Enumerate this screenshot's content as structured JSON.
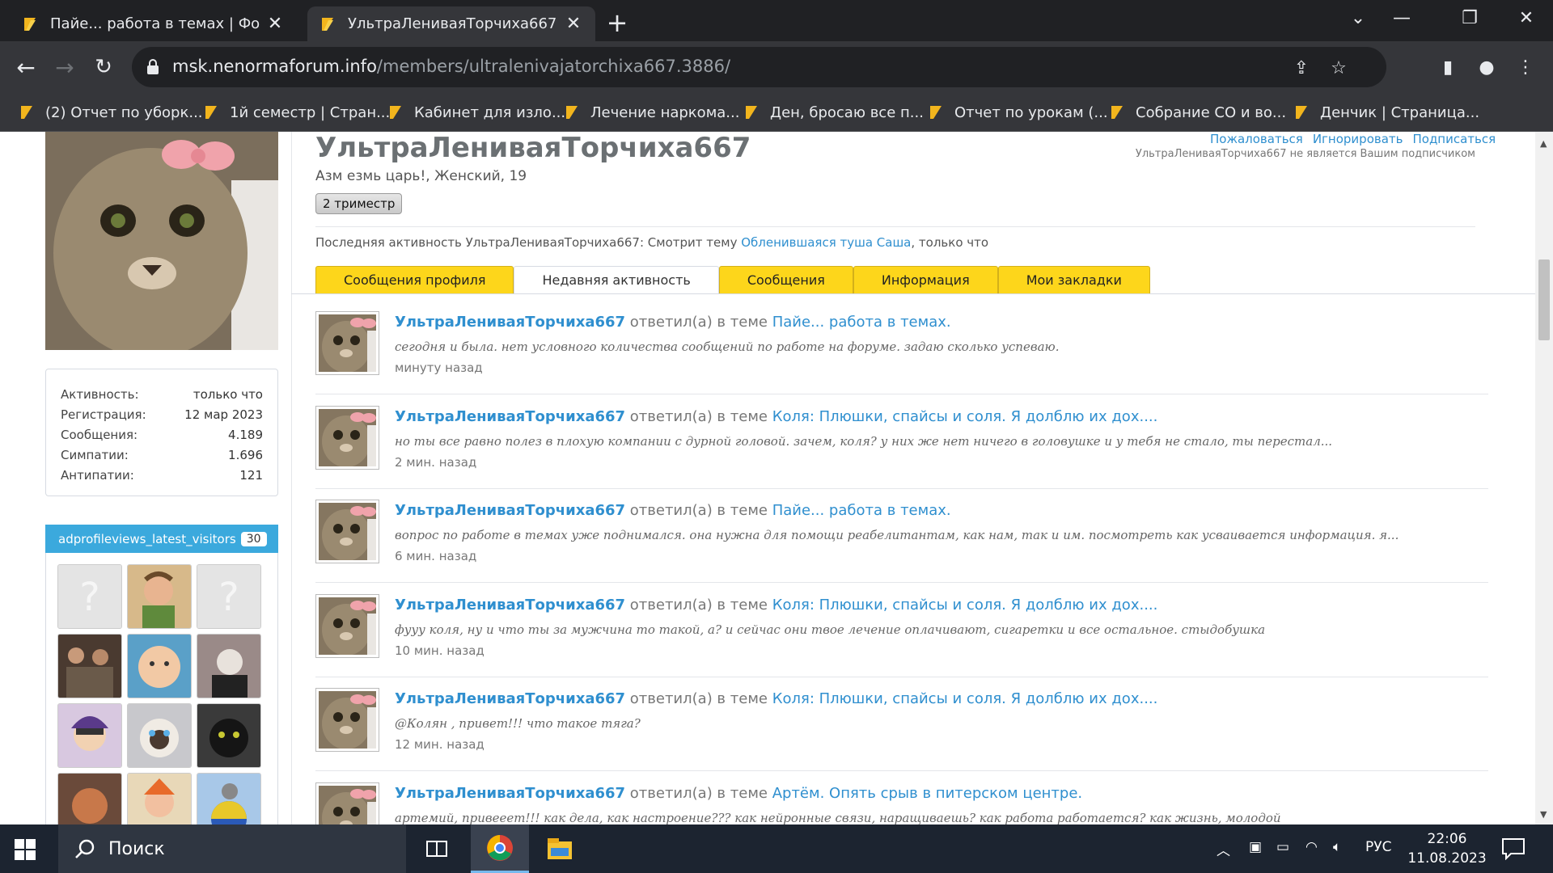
{
  "browser": {
    "tabs": [
      {
        "title": "Пайе... работа в темах | Форум р",
        "active": false
      },
      {
        "title": "УльтраЛениваяТорчиха667 | Фо",
        "active": true
      }
    ],
    "url_host": "msk.nenormaforum.info",
    "url_path": "/members/ultralenivajatorchixa667.3886/",
    "bookmarks": [
      "(2) Отчет по уборк...",
      "1й семестр | Стран...",
      "Кабинет для изло...",
      "Лечение наркома...",
      "Ден, бросаю все п...",
      "Отчет по урокам (...",
      "Собрание СО и во...",
      "Денчик | Страница..."
    ]
  },
  "profile": {
    "name": "УльтраЛениваяТорчиха667",
    "subtitle": "Азм езмь царь!, Женский, 19",
    "badge": "2 триместр",
    "actions": {
      "report": "Пожаловаться",
      "ignore": "Игнорировать",
      "follow": "Подписаться"
    },
    "follow_status": "УльтраЛениваяТорчиха667 не является Вашим подписчиком",
    "last_activity_prefix": "Последняя активность УльтраЛениваяТорчиха667: Смотрит тему",
    "last_activity_thread": "Обленившаяся туша Саша",
    "last_activity_suffix": ", только что"
  },
  "stats": [
    {
      "label": "Активность:",
      "value": "только что"
    },
    {
      "label": "Регистрация:",
      "value": "12 мар 2023"
    },
    {
      "label": "Сообщения:",
      "value": "4.189"
    },
    {
      "label": "Симпатии:",
      "value": "1.696"
    },
    {
      "label": "Антипатии:",
      "value": "121"
    }
  ],
  "visitors": {
    "title": "adprofileviews_latest_visitors",
    "count": "30"
  },
  "tabs": [
    {
      "label": "Сообщения профиля",
      "active": false
    },
    {
      "label": "Недавняя активность",
      "active": true
    },
    {
      "label": "Сообщения",
      "active": false
    },
    {
      "label": "Информация",
      "active": false
    },
    {
      "label": "Мои закладки",
      "active": false
    }
  ],
  "activity": [
    {
      "user": "УльтраЛениваяТорчиха667",
      "verb": " ответил(а) в теме ",
      "thread": "Пайе... работа в темах.",
      "snippet": "сегодня и была. нет условного количества сообщений по работе на форуме. задаю сколько успеваю.",
      "time": "минуту назад"
    },
    {
      "user": "УльтраЛениваяТорчиха667",
      "verb": " ответил(а) в теме ",
      "thread": "Коля: Плюшки, спайсы и соля. Я долблю их дох....",
      "snippet": "но ты все равно полез в плохую компании с дурной головой. зачем, коля? у них же нет ничего в головушке и у тебя не стало, ты перестал...",
      "time": "2 мин. назад"
    },
    {
      "user": "УльтраЛениваяТорчиха667",
      "verb": " ответил(а) в теме ",
      "thread": "Пайе... работа в темах.",
      "snippet": "вопрос по работе в темах уже поднимался. она нужна для помощи реабелитантам, как нам, так и им. посмотреть как усваивается информация. я...",
      "time": "6 мин. назад"
    },
    {
      "user": "УльтраЛениваяТорчиха667",
      "verb": " ответил(а) в теме ",
      "thread": "Коля: Плюшки, спайсы и соля. Я долблю их дох....",
      "snippet": "фууу коля, ну и что ты за мужчина то такой, а? и сейчас они твое лечение оплачивают, сигаретки и все остальное. стыдобушка",
      "time": "10 мин. назад"
    },
    {
      "user": "УльтраЛениваяТорчиха667",
      "verb": " ответил(а) в теме ",
      "thread": "Коля: Плюшки, спайсы и соля. Я долблю их дох....",
      "snippet": "@Колян , привет!!! что такое тяга?",
      "time": "12 мин. назад"
    },
    {
      "user": "УльтраЛениваяТорчиха667",
      "verb": " ответил(а) в теме ",
      "thread": "Артём. Опять срыв в питерском центре.",
      "snippet": "артемий, привееет!!! как дела, как настроение??? как нейронные связи, наращиваешь? как работа работается? как жизнь, молодой",
      "time": ""
    }
  ],
  "taskbar": {
    "search_placeholder": "Поиск",
    "lang": "РУС",
    "time": "22:06",
    "date": "11.08.2023"
  },
  "colors": {
    "link": "#2f8fcf",
    "tab_yellow": "#fdd61b",
    "visitors_header": "#3ba9dd"
  }
}
